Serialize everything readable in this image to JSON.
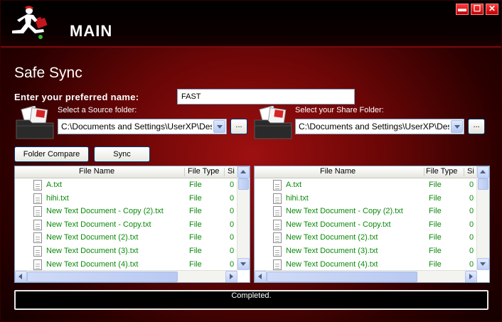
{
  "app": {
    "title": "MAIN"
  },
  "window_controls": {
    "minimize": "▬",
    "maximize": "☐",
    "close": "✕"
  },
  "heading": "Safe Sync",
  "preferred_name": {
    "label": "Enter your preferred name:",
    "value": "FAST"
  },
  "source": {
    "label": "Select a Source folder:",
    "path": "C:\\Documents and Settings\\UserXP\\Deskt",
    "browse": "..."
  },
  "share": {
    "label": "Select your Share Folder:",
    "path": "C:\\Documents and Settings\\UserXP\\Deskt",
    "browse": "..."
  },
  "buttons": {
    "folder_compare": "Folder Compare",
    "sync": "Sync"
  },
  "columns": {
    "name": "File Name",
    "type": "File Type",
    "size": "Si"
  },
  "left_list": {
    "rows": [
      {
        "name": "A.txt",
        "type": "File",
        "size": "0"
      },
      {
        "name": "hihi.txt",
        "type": "File",
        "size": "0"
      },
      {
        "name": "New Text Document - Copy (2).txt",
        "type": "File",
        "size": "0"
      },
      {
        "name": "New Text Document - Copy.txt",
        "type": "File",
        "size": "0"
      },
      {
        "name": "New Text Document (2).txt",
        "type": "File",
        "size": "0"
      },
      {
        "name": "New Text Document (3).txt",
        "type": "File",
        "size": "0"
      },
      {
        "name": "New Text Document (4).txt",
        "type": "File",
        "size": "0"
      }
    ]
  },
  "right_list": {
    "rows": [
      {
        "name": "A.txt",
        "type": "File",
        "size": "0"
      },
      {
        "name": "hihi.txt",
        "type": "File",
        "size": "0"
      },
      {
        "name": "New Text Document - Copy (2).txt",
        "type": "File",
        "size": "0"
      },
      {
        "name": "New Text Document - Copy.txt",
        "type": "File",
        "size": "0"
      },
      {
        "name": "New Text Document (2).txt",
        "type": "File",
        "size": "0"
      },
      {
        "name": "New Text Document (3).txt",
        "type": "File",
        "size": "0"
      },
      {
        "name": "New Text Document (4).txt",
        "type": "File",
        "size": "0"
      }
    ]
  },
  "status": {
    "text": "Completed."
  },
  "colors": {
    "accent_red": "#9e1010",
    "file_text_green": "#0a8a0a",
    "background_dark": "#0d0000"
  },
  "icons": [
    "runner-logo-icon",
    "folder-documents-icon",
    "file-icon",
    "scroll-arrow-icon"
  ]
}
